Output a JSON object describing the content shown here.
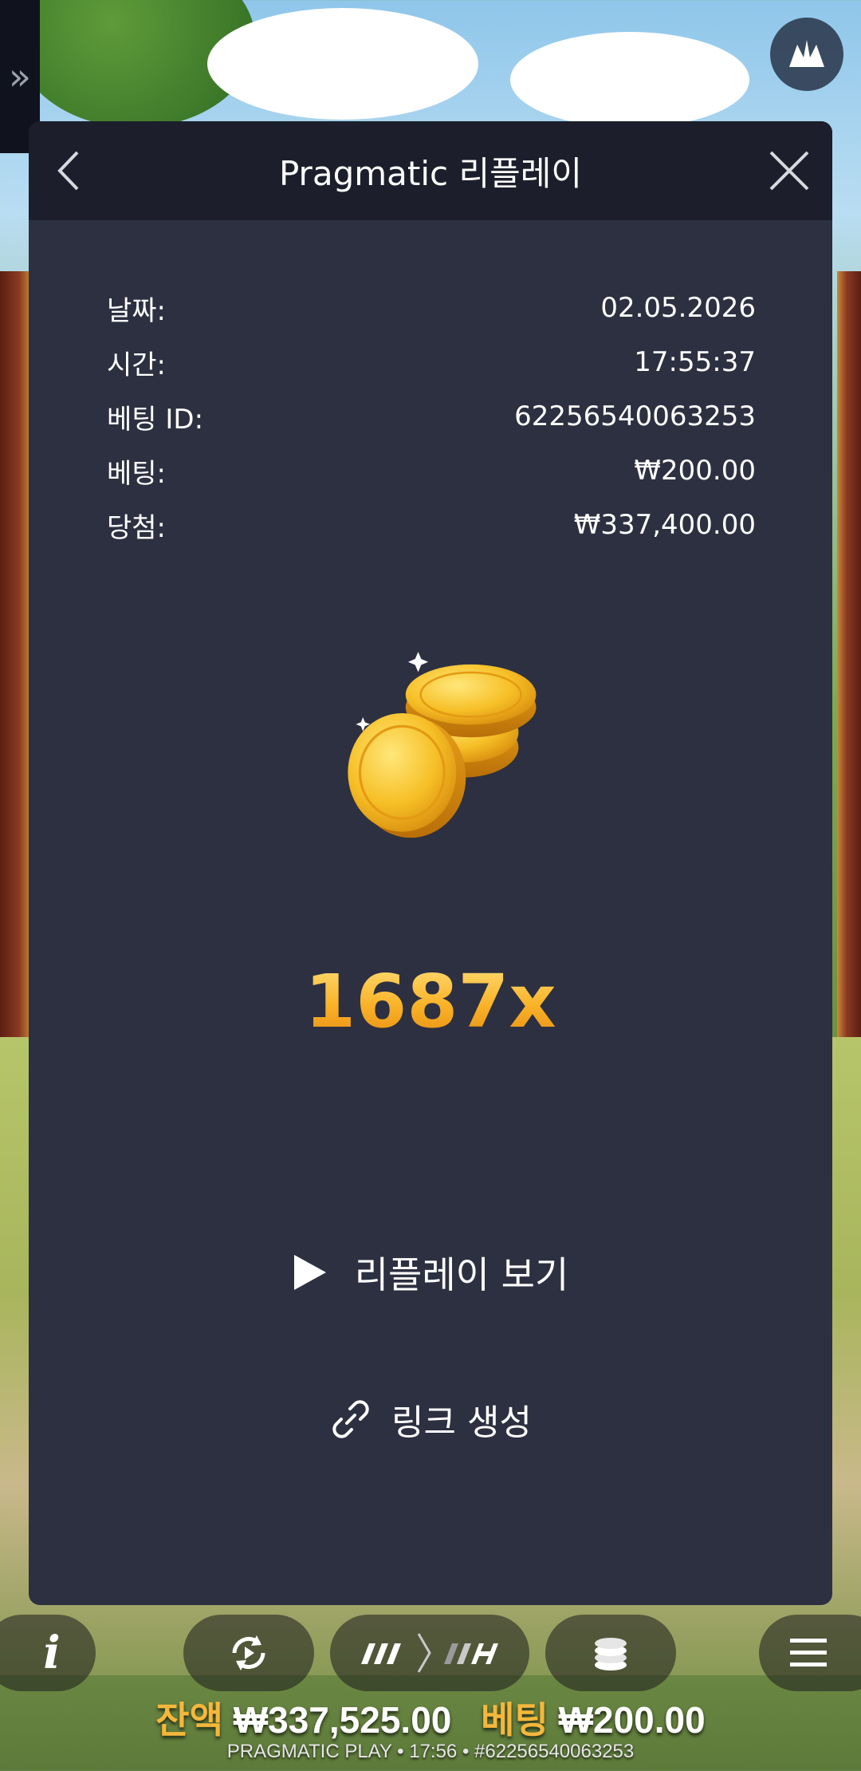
{
  "modal": {
    "title": "Pragmatic 리플레이",
    "details": [
      {
        "label": "날짜:",
        "value": "02.05.2026"
      },
      {
        "label": "시간:",
        "value": "17:55:37"
      },
      {
        "label": "베팅 ID:",
        "value": "62256540063253"
      },
      {
        "label": "베팅:",
        "value": "₩200.00"
      },
      {
        "label": "당첨:",
        "value": "₩337,400.00"
      }
    ],
    "multiplier": "1687x",
    "replay_label": "리플레이 보기",
    "link_label": "링크 생성"
  },
  "toolbar": {
    "info_label": "i"
  },
  "status": {
    "balance_label": "잔액",
    "balance_value": "₩337,525.00",
    "bet_label": "베팅",
    "bet_value": "₩200.00",
    "footer": "PRAGMATIC PLAY • 17:56 • #62256540063253"
  },
  "colors": {
    "modal_bg": "#2d3040",
    "header_bg": "#1c1f2b",
    "multiplier_gold": "#f7a21c",
    "balance_label": "#f5b73b"
  },
  "icons": [
    "chevron-left-icon",
    "close-icon",
    "play-icon",
    "link-icon",
    "autoplay-icon",
    "speed-icon",
    "coins-icon",
    "hamburger-menu-icon",
    "brand-logo-icon",
    "expand-icon"
  ]
}
